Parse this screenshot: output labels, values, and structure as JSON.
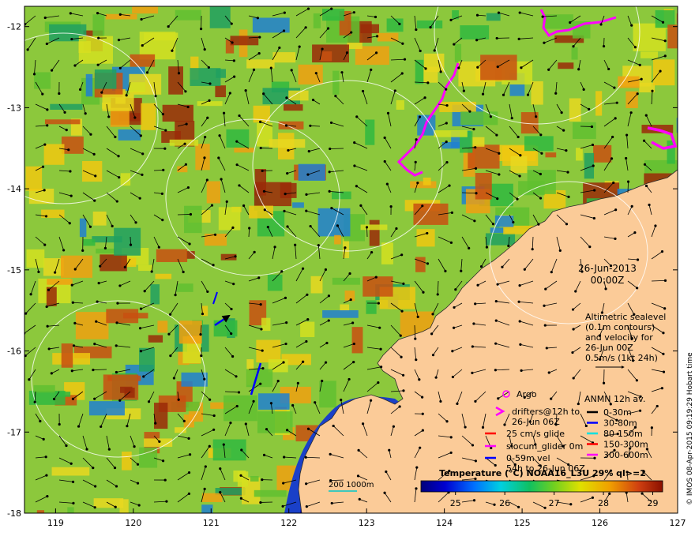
{
  "map": {
    "date": "26-Jun-2013",
    "time": "00:00Z",
    "credit": "© IMOS 08-Apr-2015 09:19:29 Hobart time",
    "lon_ticks": [
      "119",
      "120",
      "121",
      "122",
      "123",
      "124",
      "125",
      "126",
      "127"
    ],
    "lat_ticks": [
      "-12",
      "-13",
      "-14",
      "-15",
      "-16",
      "-17",
      "-18"
    ],
    "lon_range": [
      118.6,
      127
    ],
    "lat_range": [
      -18,
      -11.75
    ]
  },
  "altimetry_note": [
    "Altimetric sealevel",
    "(0.1m contours)",
    "and velocity for",
    "26-Jun 00Z",
    "0.5m/s (1kt 24h)"
  ],
  "legend_left": {
    "argo": "Argo",
    "drifters": [
      "drifters@12h to",
      "26-Jun 06Z"
    ],
    "glide": "25 cm/s glide",
    "slocum": "slocum_glider 0m",
    "vel": [
      "0-59m vel",
      "54h to 26-Jun 06Z"
    ]
  },
  "legend_anmn": {
    "title": "ANMN 12h av.",
    "items": [
      {
        "label": "0-30m",
        "color": "#000000"
      },
      {
        "label": "30-80m",
        "color": "#0000ff"
      },
      {
        "label": "80-150m",
        "color": "#00e0e0"
      },
      {
        "label": "150-300m",
        "color": "#ff0000"
      },
      {
        "label": "300-600m",
        "color": "#ff00ff"
      }
    ]
  },
  "bathy": {
    "label": "200  1000m"
  },
  "colorbar": {
    "title": "Temperature (°C) NOAA16_L3U 29% ql>=2",
    "ticks": [
      "25",
      "26",
      "27",
      "28",
      "29"
    ],
    "range": [
      24.3,
      29.2
    ]
  }
}
